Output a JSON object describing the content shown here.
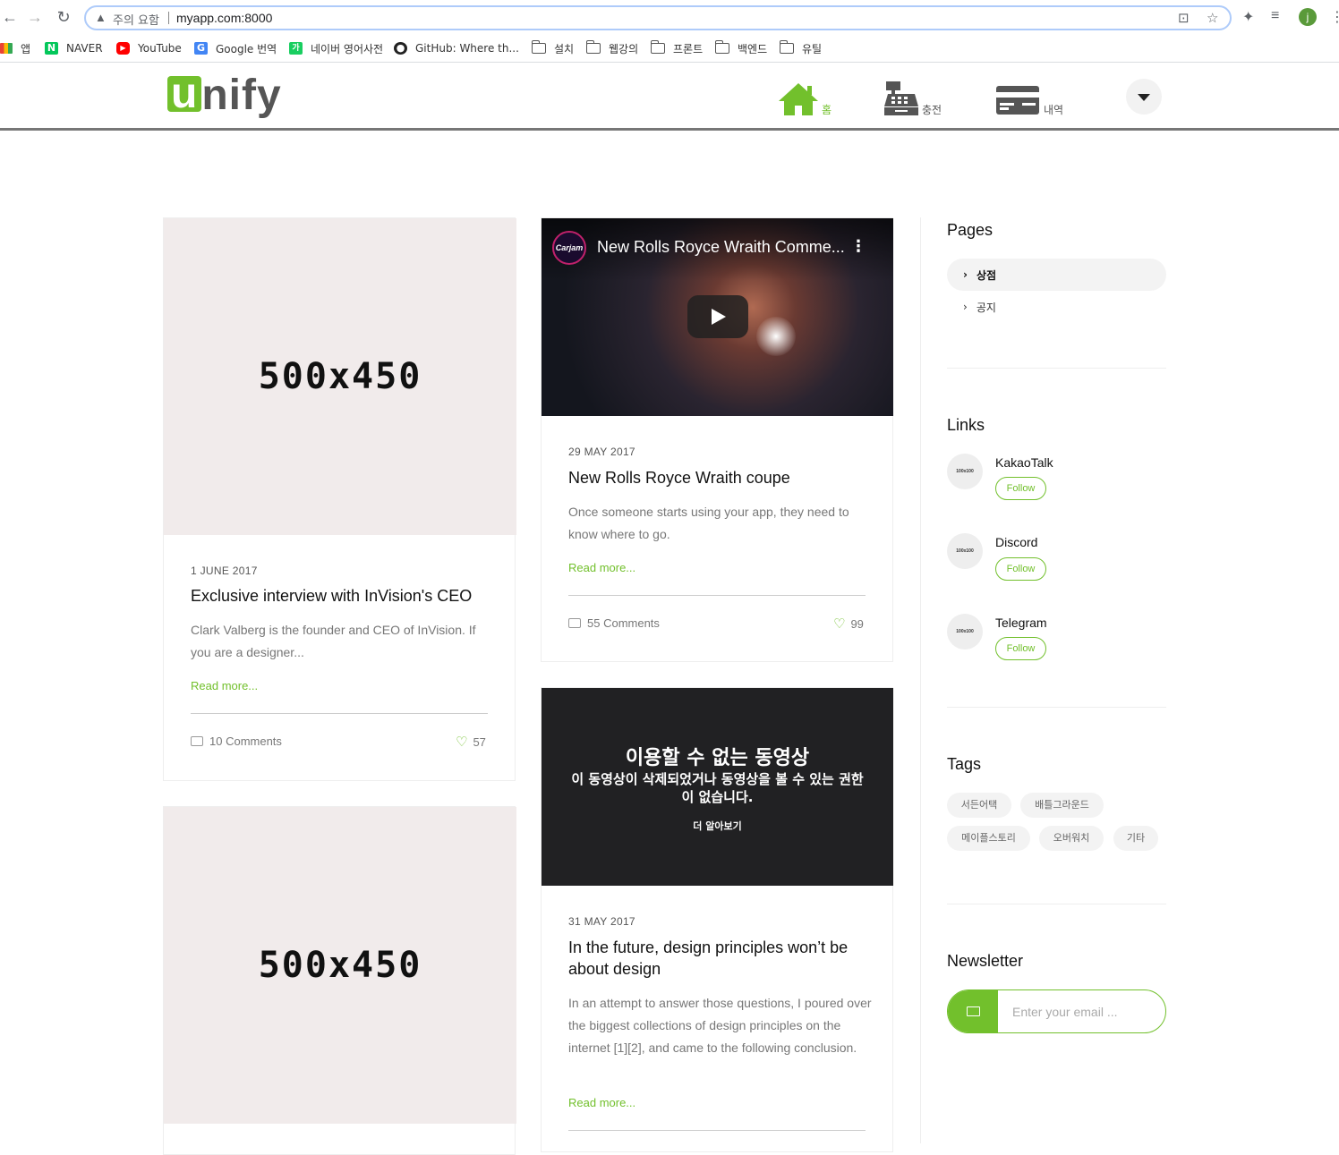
{
  "browser": {
    "security_label": "주의 요함",
    "url": "myapp.com:8000",
    "profile_initial": "j",
    "bookmarks": [
      {
        "label": "앱"
      },
      {
        "label": "NAVER"
      },
      {
        "label": "YouTube"
      },
      {
        "label": "Google 번역"
      },
      {
        "label": "네이버 영어사전"
      },
      {
        "label": "GitHub: Where th..."
      },
      {
        "label": "설치"
      },
      {
        "label": "웹강의"
      },
      {
        "label": "프론트"
      },
      {
        "label": "백엔드"
      },
      {
        "label": "유틸"
      }
    ]
  },
  "header": {
    "logo_u": "u",
    "logo_rest": "nify",
    "menu": [
      {
        "label": "홈",
        "icon": "home-icon",
        "color": "#72c02c"
      },
      {
        "label": "충전",
        "icon": "cash-register-icon",
        "color": "#555555"
      },
      {
        "label": "내역",
        "icon": "credit-card-icon",
        "color": "#555555"
      }
    ]
  },
  "posts": {
    "col1": [
      {
        "image_text": "500x450",
        "date": "1 JUNE 2017",
        "title": "Exclusive interview with InVision's CEO",
        "text": "Clark Valberg is the founder and CEO of InVision. If you are a designer...",
        "read_more": "Read more...",
        "comments": "10 Comments",
        "likes": "57"
      },
      {
        "image_text": "500x450"
      }
    ],
    "col2": [
      {
        "video": {
          "channel": "Carjam",
          "title": "New Rolls Royce Wraith Comme..."
        },
        "date": "29 MAY 2017",
        "title": "New Rolls Royce Wraith coupe",
        "text": "Once someone starts using your app, they need to know where to go.",
        "read_more": "Read more...",
        "comments": "55 Comments",
        "likes": "99"
      },
      {
        "video_unavailable": {
          "title": "이용할 수 없는 동영상",
          "subtitle": "이 동영상이 삭제되었거나 동영상을 볼 수 있는 권한이 없습니다.",
          "link": "더 알아보기"
        },
        "date": "31 MAY 2017",
        "title": "In the future, design principles won’t be about design",
        "text": "In an attempt to answer those questions, I poured over the biggest collections of design principles on the internet [1][2], and came to the following conclusion.",
        "read_more": "Read more..."
      }
    ]
  },
  "sidebar": {
    "pages": {
      "title": "Pages",
      "items": [
        {
          "label": "상점",
          "active": true
        },
        {
          "label": "공지",
          "active": false
        }
      ]
    },
    "links": {
      "title": "Links",
      "avatar_text": "100x100",
      "follow_label": "Follow",
      "items": [
        {
          "name": "KakaoTalk"
        },
        {
          "name": "Discord"
        },
        {
          "name": "Telegram"
        }
      ]
    },
    "tags": {
      "title": "Tags",
      "items": [
        "서든어택",
        "배틀그라운드",
        "메이플스토리",
        "오버워치",
        "기타"
      ]
    },
    "newsletter": {
      "title": "Newsletter",
      "placeholder": "Enter your email ..."
    }
  },
  "colors": {
    "accent": "#72c02c"
  }
}
